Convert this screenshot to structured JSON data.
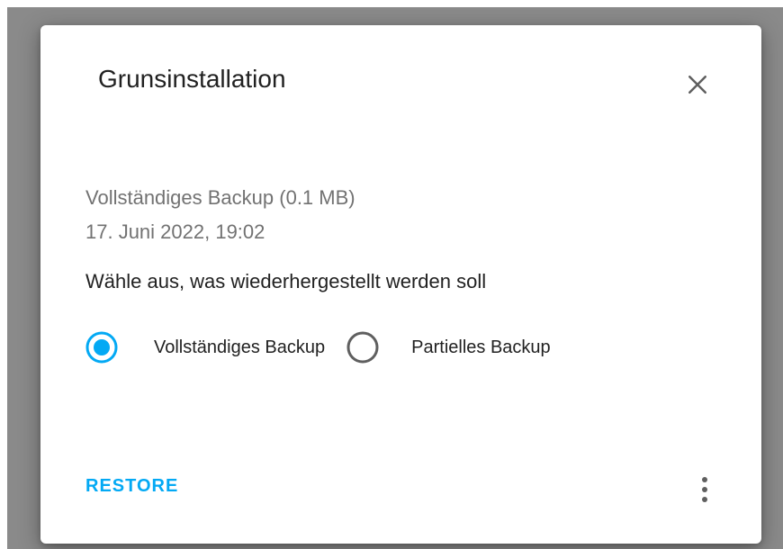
{
  "dialog": {
    "title": "Grunsinstallation",
    "close_icon": "close-icon",
    "backup_type": "Vollständiges Backup (0.1 MB)",
    "backup_date": "17. Juni 2022, 19:02",
    "prompt": "Wähle aus, was wiederhergestellt werden soll",
    "options": [
      {
        "label": "Vollständiges Backup",
        "selected": true
      },
      {
        "label": "Partielles Backup",
        "selected": false
      }
    ],
    "restore_label": "RESTORE",
    "menu_icon": "more-vertical-icon"
  },
  "colors": {
    "accent": "#03a9f4",
    "text_primary": "#212121",
    "text_secondary": "#727272",
    "radio_unselected": "#5f5f5f",
    "backdrop": "#8a8a8a"
  }
}
